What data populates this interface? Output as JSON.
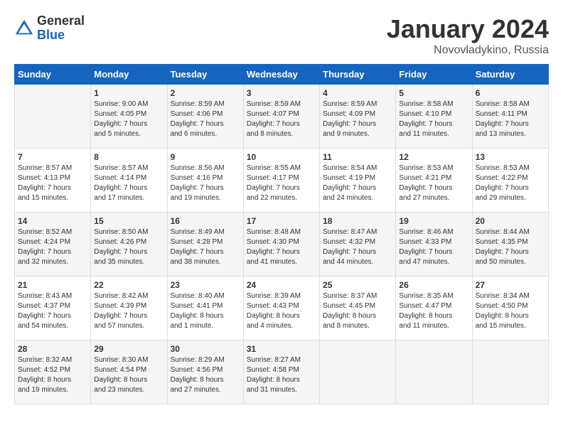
{
  "header": {
    "logo_general": "General",
    "logo_blue": "Blue",
    "month": "January 2024",
    "location": "Novovladykino, Russia"
  },
  "days_of_week": [
    "Sunday",
    "Monday",
    "Tuesday",
    "Wednesday",
    "Thursday",
    "Friday",
    "Saturday"
  ],
  "weeks": [
    [
      {
        "num": "",
        "info": ""
      },
      {
        "num": "1",
        "info": "Sunrise: 9:00 AM\nSunset: 4:05 PM\nDaylight: 7 hours\nand 5 minutes."
      },
      {
        "num": "2",
        "info": "Sunrise: 8:59 AM\nSunset: 4:06 PM\nDaylight: 7 hours\nand 6 minutes."
      },
      {
        "num": "3",
        "info": "Sunrise: 8:59 AM\nSunset: 4:07 PM\nDaylight: 7 hours\nand 8 minutes."
      },
      {
        "num": "4",
        "info": "Sunrise: 8:59 AM\nSunset: 4:09 PM\nDaylight: 7 hours\nand 9 minutes."
      },
      {
        "num": "5",
        "info": "Sunrise: 8:58 AM\nSunset: 4:10 PM\nDaylight: 7 hours\nand 11 minutes."
      },
      {
        "num": "6",
        "info": "Sunrise: 8:58 AM\nSunset: 4:11 PM\nDaylight: 7 hours\nand 13 minutes."
      }
    ],
    [
      {
        "num": "7",
        "info": "Sunrise: 8:57 AM\nSunset: 4:13 PM\nDaylight: 7 hours\nand 15 minutes."
      },
      {
        "num": "8",
        "info": "Sunrise: 8:57 AM\nSunset: 4:14 PM\nDaylight: 7 hours\nand 17 minutes."
      },
      {
        "num": "9",
        "info": "Sunrise: 8:56 AM\nSunset: 4:16 PM\nDaylight: 7 hours\nand 19 minutes."
      },
      {
        "num": "10",
        "info": "Sunrise: 8:55 AM\nSunset: 4:17 PM\nDaylight: 7 hours\nand 22 minutes."
      },
      {
        "num": "11",
        "info": "Sunrise: 8:54 AM\nSunset: 4:19 PM\nDaylight: 7 hours\nand 24 minutes."
      },
      {
        "num": "12",
        "info": "Sunrise: 8:53 AM\nSunset: 4:21 PM\nDaylight: 7 hours\nand 27 minutes."
      },
      {
        "num": "13",
        "info": "Sunrise: 8:53 AM\nSunset: 4:22 PM\nDaylight: 7 hours\nand 29 minutes."
      }
    ],
    [
      {
        "num": "14",
        "info": "Sunrise: 8:52 AM\nSunset: 4:24 PM\nDaylight: 7 hours\nand 32 minutes."
      },
      {
        "num": "15",
        "info": "Sunrise: 8:50 AM\nSunset: 4:26 PM\nDaylight: 7 hours\nand 35 minutes."
      },
      {
        "num": "16",
        "info": "Sunrise: 8:49 AM\nSunset: 4:28 PM\nDaylight: 7 hours\nand 38 minutes."
      },
      {
        "num": "17",
        "info": "Sunrise: 8:48 AM\nSunset: 4:30 PM\nDaylight: 7 hours\nand 41 minutes."
      },
      {
        "num": "18",
        "info": "Sunrise: 8:47 AM\nSunset: 4:32 PM\nDaylight: 7 hours\nand 44 minutes."
      },
      {
        "num": "19",
        "info": "Sunrise: 8:46 AM\nSunset: 4:33 PM\nDaylight: 7 hours\nand 47 minutes."
      },
      {
        "num": "20",
        "info": "Sunrise: 8:44 AM\nSunset: 4:35 PM\nDaylight: 7 hours\nand 50 minutes."
      }
    ],
    [
      {
        "num": "21",
        "info": "Sunrise: 8:43 AM\nSunset: 4:37 PM\nDaylight: 7 hours\nand 54 minutes."
      },
      {
        "num": "22",
        "info": "Sunrise: 8:42 AM\nSunset: 4:39 PM\nDaylight: 7 hours\nand 57 minutes."
      },
      {
        "num": "23",
        "info": "Sunrise: 8:40 AM\nSunset: 4:41 PM\nDaylight: 8 hours\nand 1 minute."
      },
      {
        "num": "24",
        "info": "Sunrise: 8:39 AM\nSunset: 4:43 PM\nDaylight: 8 hours\nand 4 minutes."
      },
      {
        "num": "25",
        "info": "Sunrise: 8:37 AM\nSunset: 4:45 PM\nDaylight: 8 hours\nand 8 minutes."
      },
      {
        "num": "26",
        "info": "Sunrise: 8:35 AM\nSunset: 4:47 PM\nDaylight: 8 hours\nand 11 minutes."
      },
      {
        "num": "27",
        "info": "Sunrise: 8:34 AM\nSunset: 4:50 PM\nDaylight: 8 hours\nand 15 minutes."
      }
    ],
    [
      {
        "num": "28",
        "info": "Sunrise: 8:32 AM\nSunset: 4:52 PM\nDaylight: 8 hours\nand 19 minutes."
      },
      {
        "num": "29",
        "info": "Sunrise: 8:30 AM\nSunset: 4:54 PM\nDaylight: 8 hours\nand 23 minutes."
      },
      {
        "num": "30",
        "info": "Sunrise: 8:29 AM\nSunset: 4:56 PM\nDaylight: 8 hours\nand 27 minutes."
      },
      {
        "num": "31",
        "info": "Sunrise: 8:27 AM\nSunset: 4:58 PM\nDaylight: 8 hours\nand 31 minutes."
      },
      {
        "num": "",
        "info": ""
      },
      {
        "num": "",
        "info": ""
      },
      {
        "num": "",
        "info": ""
      }
    ]
  ]
}
